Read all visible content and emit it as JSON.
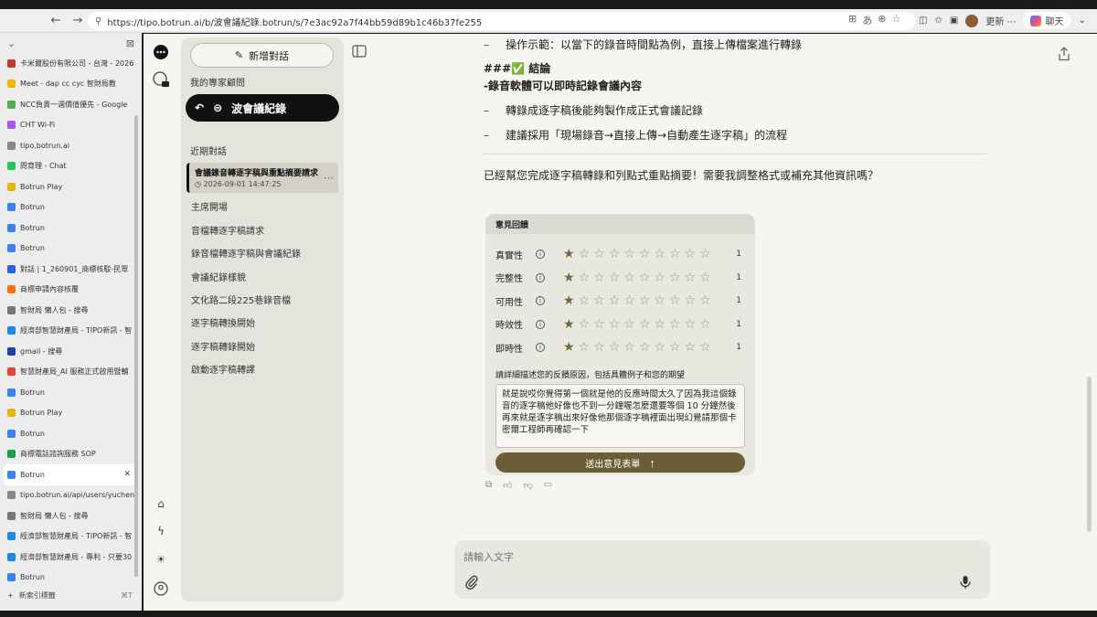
{
  "browser": {
    "url": "https://tipo.botrun.ai/b/波會議紀錄.botrun/s/7e3ac92a7f44bb59d89b1c46b37fe255",
    "update_label": "更新",
    "chat_label": "聊天"
  },
  "tabs": [
    {
      "title": "卡米爾股份有限公司 - 台灣 - 2026",
      "color": "#c0392b",
      "glyph": ""
    },
    {
      "title": "Meet - dap cc cyc 智財局教",
      "color": "#f4b400",
      "glyph": ""
    },
    {
      "title": "NCC負責一週價值優先 - Google",
      "color": "#4caf50",
      "glyph": ""
    },
    {
      "title": "CHT Wi-Fi",
      "color": "#a855f7",
      "glyph": ""
    },
    {
      "title": "tipo.botrun.ai",
      "color": "#888888",
      "glyph": ""
    },
    {
      "title": "問育理 - Chat",
      "color": "#22c55e",
      "glyph": ""
    },
    {
      "title": "Botrun Play",
      "color": "#eab308",
      "glyph": ""
    },
    {
      "title": "Botrun",
      "color": "#3b82f6",
      "glyph": ""
    },
    {
      "title": "Botrun",
      "color": "#3b82f6",
      "glyph": ""
    },
    {
      "title": "Botrun",
      "color": "#3b82f6",
      "glyph": ""
    },
    {
      "title": "對話 | 1_260901_商標核駁-民眾",
      "color": "#2563eb",
      "glyph": ""
    },
    {
      "title": "商標申請內容核覆",
      "color": "#f97316",
      "glyph": ""
    },
    {
      "title": "智財局 懶人包 - 搜尋",
      "color": "#777777",
      "glyph": ""
    },
    {
      "title": "經濟部智慧財產局 - TIPO新訊 - 智",
      "color": "#1e88e5",
      "glyph": ""
    },
    {
      "title": "gmail - 搜尋",
      "color": "#1e40af",
      "glyph": ""
    },
    {
      "title": "智慧財產局_AI 服務正式啟用暨輔",
      "color": "#ea4335",
      "glyph": ""
    },
    {
      "title": "Botrun",
      "color": "#3b82f6",
      "glyph": ""
    },
    {
      "title": "Botrun Play",
      "color": "#eab308",
      "glyph": ""
    },
    {
      "title": "Botrun",
      "color": "#3b82f6",
      "glyph": ""
    },
    {
      "title": "商標電話諮詢服務 SOP",
      "color": "#16a34a",
      "glyph": ""
    },
    {
      "title": "Botrun",
      "color": "#3b82f6",
      "glyph": "",
      "active": true
    },
    {
      "title": "tipo.botrun.ai/api/users/yuchen_",
      "color": "#888888",
      "glyph": ""
    },
    {
      "title": "智財局 懶人包 - 搜尋",
      "color": "#777777",
      "glyph": ""
    },
    {
      "title": "經濟部智慧財產局 - TIPO新訊 - 智",
      "color": "#1e88e5",
      "glyph": ""
    },
    {
      "title": "經濟部智慧財產局 - 專利 - 只要30",
      "color": "#1e88e5",
      "glyph": ""
    },
    {
      "title": "Botrun",
      "color": "#3b82f6",
      "glyph": ""
    }
  ],
  "new_tab": {
    "label": "新索引標籤",
    "shortcut": "⌘T"
  },
  "sidebar": {
    "new_chat": "新增對話",
    "experts_label": "我的專家顧問",
    "expert_name": "波會議紀錄",
    "recent_label": "近期對話",
    "active_chat": {
      "title": "會議錄音轉逐字稿與重點摘要請求",
      "date": "2026-09-01 14:47:25"
    },
    "history": [
      "主席開場",
      "音檔轉逐字稿請求",
      "錄音檔轉逐字稿與會議紀錄",
      "會議紀錄樣貌",
      "文化路二段225巷錄音檔",
      "逐字稿轉換開始",
      "逐字稿轉錄開始",
      "啟動逐字稿轉譯"
    ]
  },
  "content": {
    "line1": "操作示範：以當下的錄音時間點為例，直接上傳檔案進行轉錄",
    "heading": "###✅ 結論",
    "line2": "-錄音軟體可以即時記錄會議內容",
    "line3": "轉錄成逐字稿後能夠製作成正式會議記錄",
    "line4": "建議採用「現場錄音→直接上傳→自動產生逐字稿」的流程",
    "closing": "已經幫您完成逐字稿轉錄和列點式重點摘要！需要我調整格式或補充其他資訊嗎？"
  },
  "feedback": {
    "title": "意見回饋",
    "ratings": [
      {
        "label": "真實性",
        "value": 1,
        "max": 10
      },
      {
        "label": "完整性",
        "value": 1,
        "max": 10
      },
      {
        "label": "可用性",
        "value": 1,
        "max": 10
      },
      {
        "label": "時效性",
        "value": 1,
        "max": 10
      },
      {
        "label": "即時性",
        "value": 1,
        "max": 10
      }
    ],
    "prompt": "請詳細描述您的反饋原因，包括具體例子和您的期望",
    "text": "就是說哎你覺得第一個就是他的反應時間太久了因為我這個錄音的逐字稿他好像也不到一分鐘喔怎麼還要等個 10 分鐘然後再來就是逐字稿出來好像他那個逐字稿裡面出現幻覺請那個卡密爾工程師再確認一下",
    "submit": "送出意見表單"
  },
  "composer": {
    "placeholder": "請輸入文字"
  }
}
